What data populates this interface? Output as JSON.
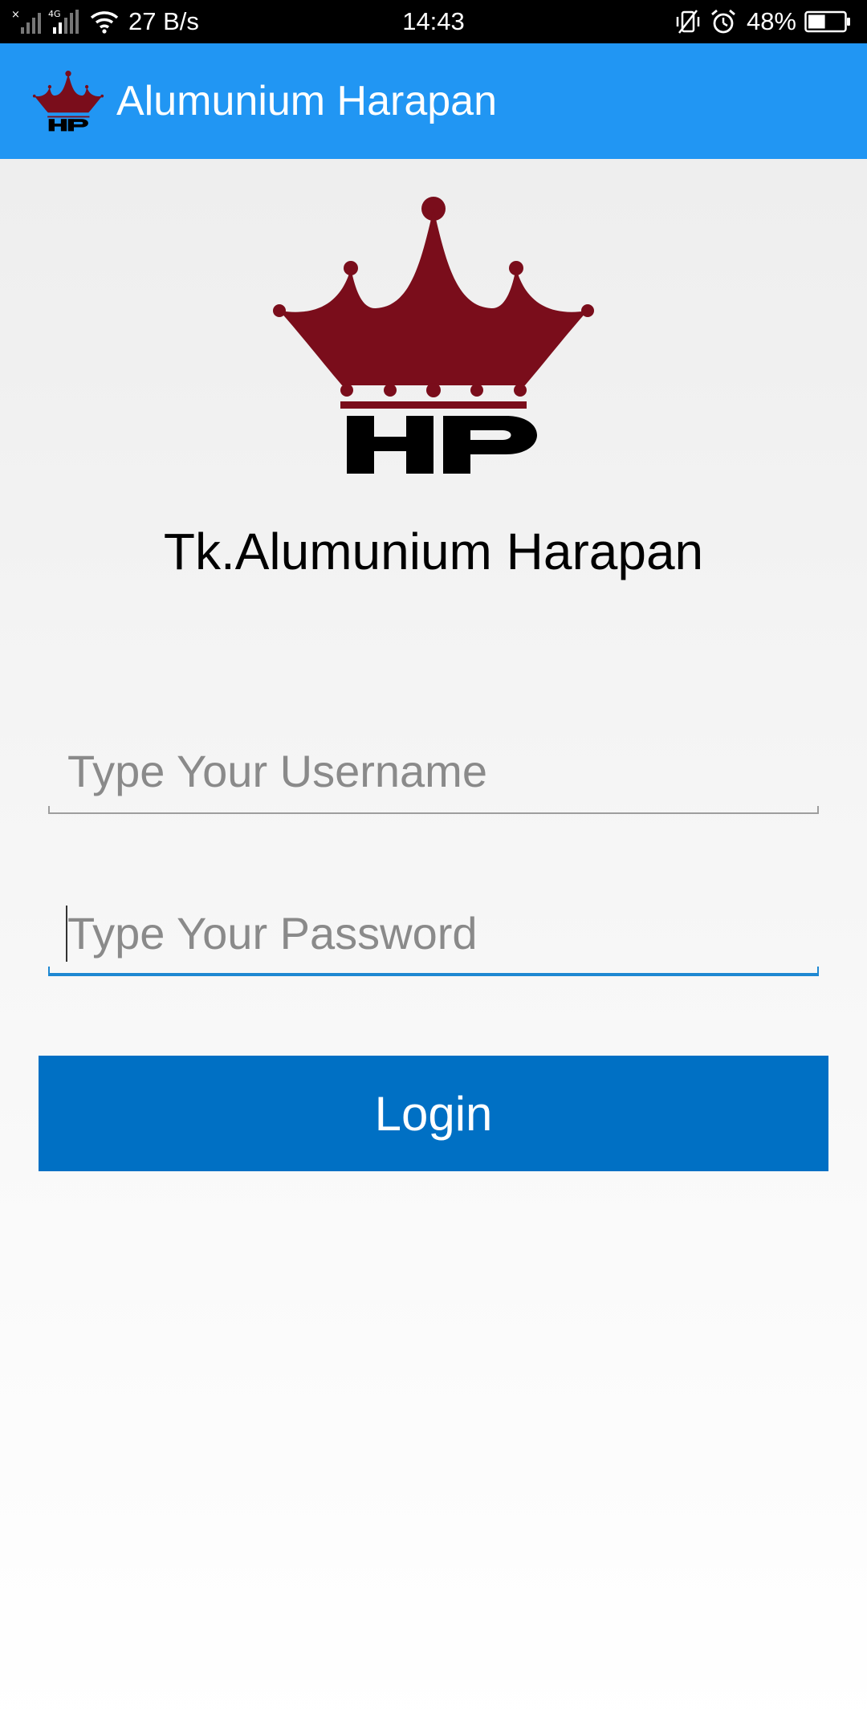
{
  "status_bar": {
    "network_speed": "27 B/s",
    "network_type": "4G",
    "time": "14:43",
    "battery_percent": "48%",
    "battery_level": 0.48,
    "icons": [
      "no-sim-signal-icon",
      "cell-signal-icon",
      "wifi-icon",
      "vibrate-icon",
      "alarm-icon",
      "battery-icon"
    ]
  },
  "app_bar": {
    "title": "Alumunium Harapan",
    "color": "#2196f3",
    "logo_icon": "crown-hp-logo"
  },
  "main": {
    "logo": {
      "icon": "crown-hp-logo",
      "monogram": "HP",
      "crown_color": "#7a0d1b"
    },
    "store_name": "Tk.Alumunium Harapan",
    "username": {
      "value": "",
      "placeholder": "Type Your Username"
    },
    "password": {
      "value": "",
      "placeholder": "Type Your Password",
      "focused": true
    },
    "login_label": "Login",
    "login_color": "#0070c4"
  }
}
